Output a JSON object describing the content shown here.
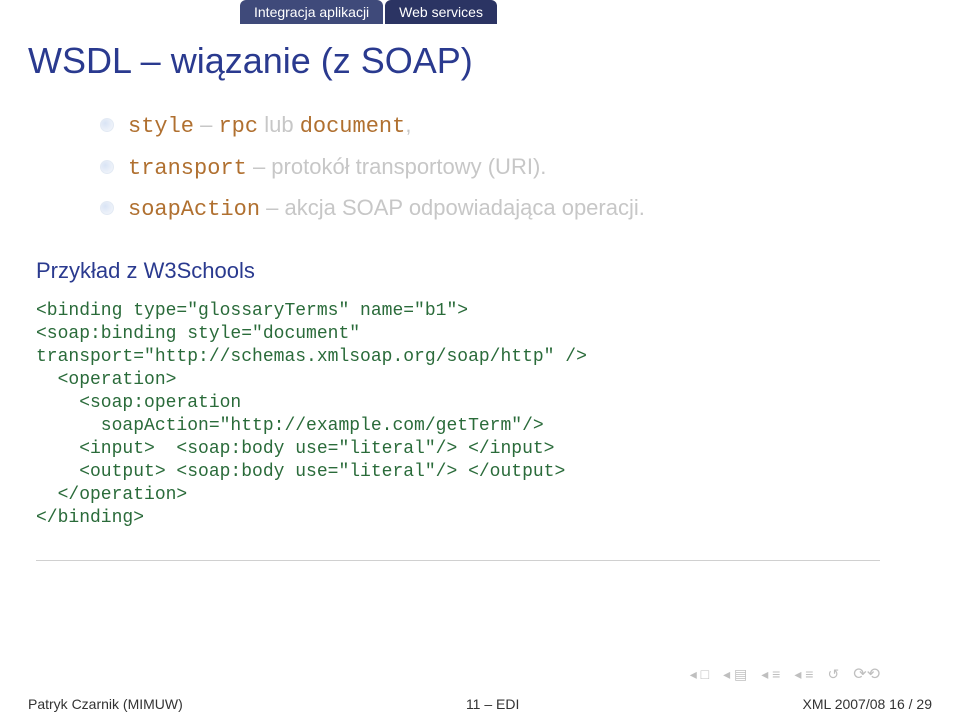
{
  "tabs": {
    "left": "Integracja aplikacji",
    "right": "Web services"
  },
  "title": "WSDL – wiązanie (z SOAP)",
  "bullets": [
    {
      "code": "style",
      "sep": " – ",
      "code2": "rpc",
      "mid": " lub ",
      "code3": "document",
      "tail": ","
    },
    {
      "code": "transport",
      "sep": " – ",
      "text": "protokół transportowy (URI)."
    },
    {
      "code": "soapAction",
      "sep": " – ",
      "text": "akcja SOAP odpowiadająca operacji."
    }
  ],
  "block_title": "Przykład z W3Schools",
  "code": "<binding type=\"glossaryTerms\" name=\"b1\">\n<soap:binding style=\"document\"\ntransport=\"http://schemas.xmlsoap.org/soap/http\" />\n  <operation>\n    <soap:operation\n      soapAction=\"http://example.com/getTerm\"/>\n    <input>  <soap:body use=\"literal\"/> </input>\n    <output> <soap:body use=\"literal\"/> </output>\n  </operation>\n</binding>",
  "footer": {
    "left": "Patryk Czarnik (MIMUW)",
    "center": "11 – EDI",
    "right": "XML 2007/08    16 / 29"
  }
}
